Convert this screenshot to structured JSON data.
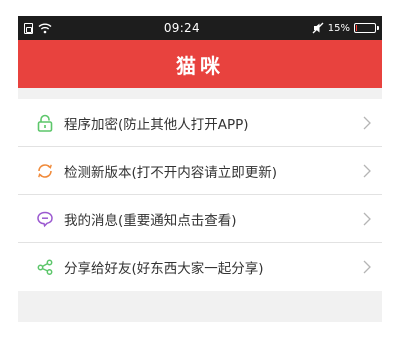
{
  "status_bar": {
    "time": "09:24",
    "battery_percent": "15%",
    "battery_level": 0.15,
    "icons": [
      "sim-icon",
      "wifi-icon",
      "mute-icon",
      "battery-icon"
    ]
  },
  "header": {
    "title": "猫咪",
    "color": "#e8423e"
  },
  "menu": {
    "items": [
      {
        "label": "程序加密(防止其他人打开APP)",
        "icon": "lock-icon",
        "color": "#5cc66a"
      },
      {
        "label": "检测新版本(打不开内容请立即更新)",
        "icon": "refresh-icon",
        "color": "#f08a3a"
      },
      {
        "label": "我的消息(重要通知点击查看)",
        "icon": "message-icon",
        "color": "#9b59d0"
      },
      {
        "label": "分享给好友(好东西大家一起分享)",
        "icon": "share-icon",
        "color": "#5cc66a"
      }
    ]
  }
}
